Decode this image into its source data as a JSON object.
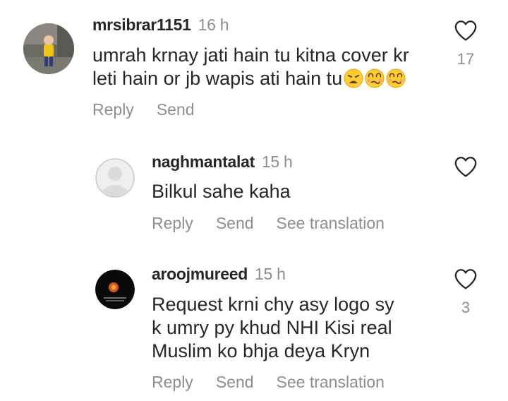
{
  "comments": [
    {
      "username": "mrsibrar1151",
      "time": "16 h",
      "lines": [
        "umrah krnay jati hain tu kitna cover kr",
        "leti hain or jb wapis ati hain tu"
      ],
      "emojis": [
        "weary-face-emoji",
        "woozy-face-emoji",
        "woozy-face-emoji"
      ],
      "actions": [
        "Reply",
        "Send"
      ],
      "likes": "17"
    },
    {
      "username": "naghmantalat",
      "time": "15 h",
      "lines": [
        "Bilkul sahe kaha"
      ],
      "actions": [
        "Reply",
        "Send",
        "See translation"
      ],
      "likes": ""
    },
    {
      "username": "aroojmureed",
      "time": "15 h",
      "lines": [
        "Request krni chy asy logo sy",
        "k umry py khud NHI Kisi real",
        "Muslim ko bhja deya Kryn"
      ],
      "actions": [
        "Reply",
        "Send",
        "See translation"
      ],
      "likes": "3"
    }
  ],
  "colors": {
    "text": "#262626",
    "secondary": "#8e8e8e",
    "background": "#ffffff"
  },
  "icons": [
    "heart-icon",
    "default-avatar-icon"
  ]
}
